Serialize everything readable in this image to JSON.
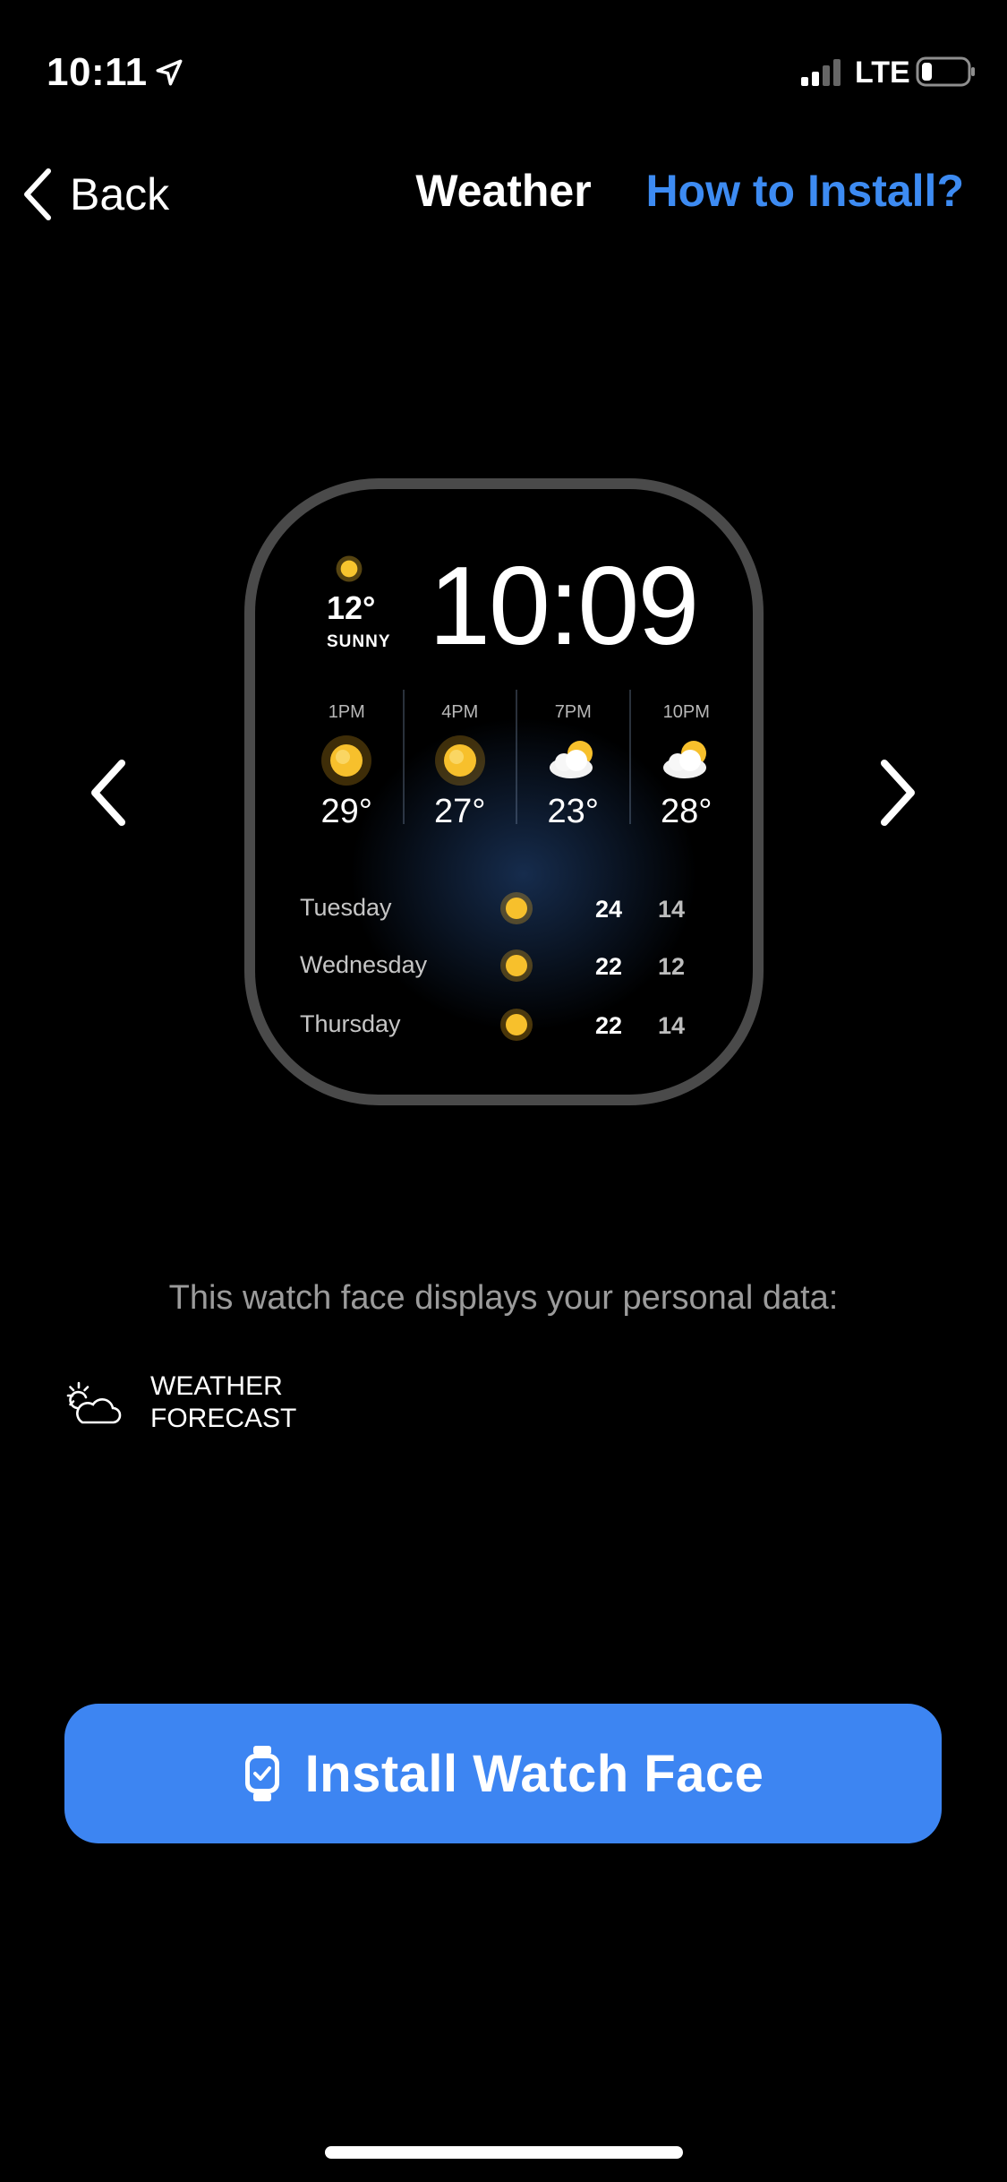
{
  "status_bar": {
    "time": "10:11",
    "network": "LTE",
    "icons": [
      "location-arrow-icon",
      "signal-icon",
      "battery-icon"
    ]
  },
  "nav": {
    "back_label": "Back",
    "title": "Weather",
    "help_link": "How to Install?"
  },
  "watch_face": {
    "current_temp": "12°",
    "current_condition": "SUNNY",
    "time": "10:09",
    "hourly": [
      {
        "label": "1PM",
        "icon": "sun-icon",
        "temp": "29°"
      },
      {
        "label": "4PM",
        "icon": "sun-icon",
        "temp": "27°"
      },
      {
        "label": "7PM",
        "icon": "partly-cloudy-icon",
        "temp": "23°"
      },
      {
        "label": "10PM",
        "icon": "partly-cloudy-icon",
        "temp": "28°"
      }
    ],
    "daily": [
      {
        "day": "Tuesday",
        "icon": "sun-icon",
        "high": "24",
        "low": "14"
      },
      {
        "day": "Wednesday",
        "icon": "sun-icon",
        "high": "22",
        "low": "12"
      },
      {
        "day": "Thursday",
        "icon": "sun-icon",
        "high": "22",
        "low": "14"
      }
    ]
  },
  "info": {
    "text": "This watch face displays your personal data:",
    "data_items": [
      {
        "icon": "weather-cloud-sun-icon",
        "line1": "WEATHER",
        "line2": "FORECAST"
      }
    ]
  },
  "install_button": {
    "label": "Install Watch Face",
    "icon": "watch-icon"
  },
  "colors": {
    "accent": "#3D85F2",
    "link": "#3D8BF2",
    "background": "#000000"
  }
}
